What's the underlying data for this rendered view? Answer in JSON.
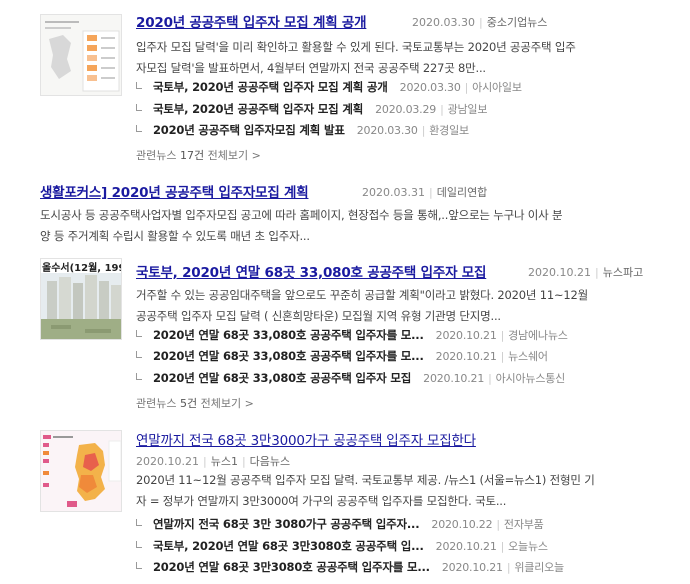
{
  "results": [
    {
      "title": "2020년 공공주택 입주자 모집 계획 공개",
      "date": "2020.03.30",
      "press": "중소기업뉴스",
      "snippet_line1": "입주자 모집 달력'을 미리 확인하고 활용할 수 있게 된다. 국토교통부는 2020년 공공주택 입주",
      "snippet_line2": "자모집 달력'을 발표하면서, 4월부터 연말까지 전국 공공주택 227곳 8만...",
      "related": [
        {
          "title": "국토부, 2020년 공공주택 입주자 모집 계획 공개",
          "date": "2020.03.30",
          "press": "아시아일보"
        },
        {
          "title": "국토부, 2020년 공공주택 입주자 모집 계획",
          "date": "2020.03.29",
          "press": "광남일보"
        },
        {
          "title": "2020년 공공주택 입주자모집 계획 발표",
          "date": "2020.03.30",
          "press": "환경일보"
        }
      ],
      "more_prefix": "관련뉴스 ",
      "more_count": "17건",
      "more_suffix": " 전체보기 >"
    },
    {
      "title": "생활포커스] 2020년 공공주택 입주자모집 계획",
      "date": "2020.03.31",
      "press": "데일리연합",
      "snippet_line1": "도시공사 등 공공주택사업자별 입주자모집 공고에 따라 홈페이지, 현장접수 등을 통해,..앞으로는 누구나 이사 분",
      "snippet_line2": "양 등 주거계획 수립시 활용할 수 있도록 매년 초 입주자..."
    },
    {
      "thumb_text": "올수서(12월, 199",
      "title": "국토부, 2020년 연말 68곳 33,080호 공공주택 입주자 모집",
      "date": "2020.10.21",
      "press": "뉴스파고",
      "snippet_line1": "거주할 수 있는 공공임대주택을 앞으로도 꾸준히 공급할 계획\"이라고 밝혔다. 2020년 11~12월",
      "snippet_line2": "공공주택 입주자 모집 달력 ( 신혼희망타운) 모집월 지역 유형 기관명 단지명...",
      "related": [
        {
          "title": "2020년 연말 68곳 33,080호 공공주택 입주자를 모...",
          "date": "2020.10.21",
          "press": "경남에나뉴스"
        },
        {
          "title": "2020년 연말 68곳 33,080호 공공주택 입주자를 모...",
          "date": "2020.10.21",
          "press": "뉴스쉐어"
        },
        {
          "title": "2020년 연말 68곳 33,080호 공공주택 입주자 모집",
          "date": "2020.10.21",
          "press": "아시아뉴스통신"
        }
      ],
      "more_prefix": "관련뉴스 ",
      "more_count": "5건",
      "more_suffix": " 전체보기 >"
    },
    {
      "title": "연말까지 전국 68곳 3만3000가구 공공주택 입주자 모집한다",
      "date": "2020.10.21",
      "press": "뉴스1",
      "press2": "다음뉴스",
      "snippet_line1": "2020년 11~12월 공공주택 입주자 모집 달력. 국토교통부 제공. /뉴스1 (서울=뉴스1) 전형민 기",
      "snippet_line2": "자 = 정부가 연말까지 3만3000여 가구의 공공주택 입주자를 모집한다. 국토...",
      "related": [
        {
          "title": "연말까지 전국 68곳 3만 3080가구 공공주택 입주자...",
          "date": "2020.10.22",
          "press": "전자부품"
        },
        {
          "title": "국토부, 2020년 연말 68곳 3만3080호 공공주택 입...",
          "date": "2020.10.21",
          "press": "오늘뉴스"
        },
        {
          "title": "2020년 연말 68곳 3만3080호 공공주택 입주자를 모...",
          "date": "2020.10.21",
          "press": "위클리오늘"
        }
      ]
    }
  ]
}
